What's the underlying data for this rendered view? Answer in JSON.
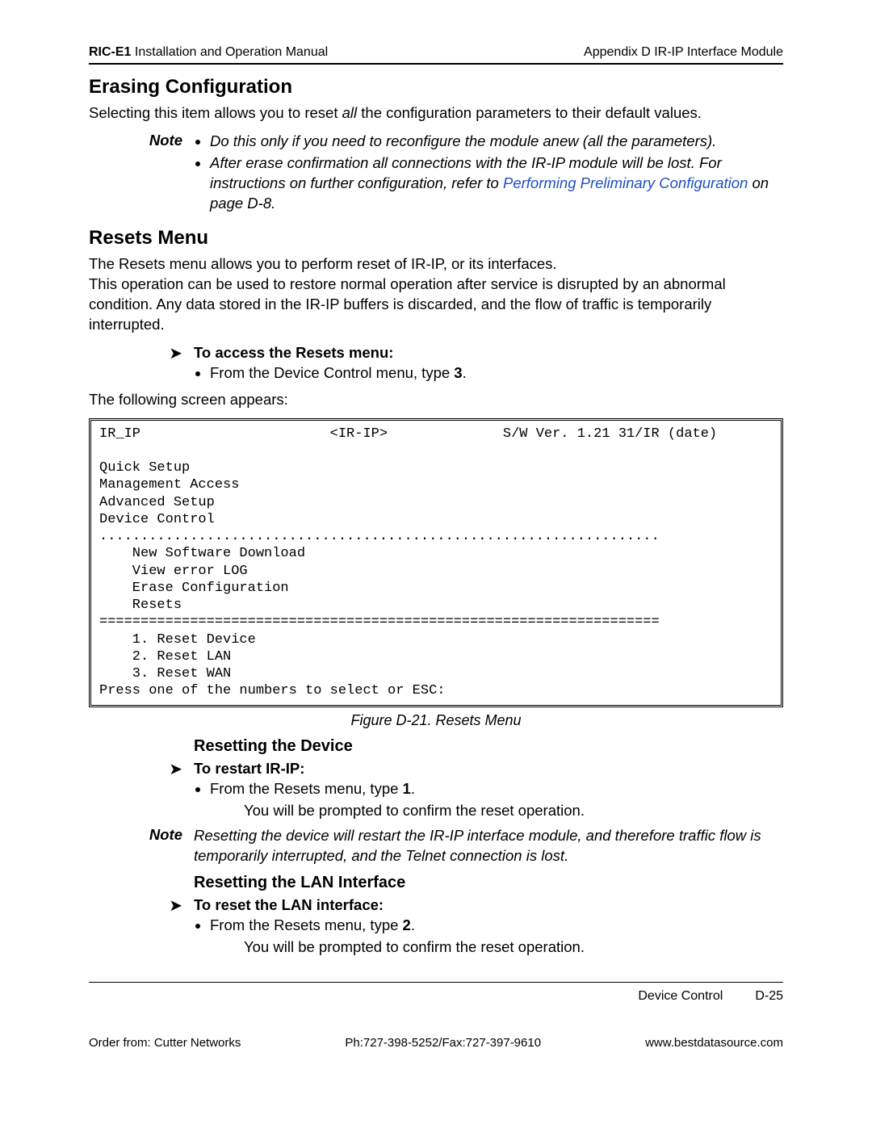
{
  "header": {
    "manual_prefix": "RIC-E1",
    "manual_rest": " Installation and Operation Manual",
    "appendix": "Appendix D  IR-IP Interface Module"
  },
  "section1": {
    "title": "Erasing Configuration",
    "para_a": "Selecting this item allows you to reset ",
    "para_b_italic": "all",
    "para_c": " the configuration parameters to their default values."
  },
  "note1": {
    "label": "Note",
    "bullet1": "Do this only if you need to reconfigure the module anew (all the parameters).",
    "bullet2_a": "After erase confirmation all connections with the IR-IP module will be lost. For instructions on further configuration, refer to ",
    "bullet2_link": "Performing Preliminary Configuration",
    "bullet2_b": " on page D-8."
  },
  "section2": {
    "title": "Resets Menu",
    "para": "The Resets menu allows you to perform reset of IR-IP, or its interfaces.\nThis operation can be used to restore normal operation after service is disrupted by an abnormal condition. Any data stored in the IR-IP buffers is discarded, and the flow of traffic is temporarily interrupted.",
    "proc_title": "To access the Resets menu:",
    "proc_step_a": "From the Device Control menu, type ",
    "proc_step_b": "3",
    "proc_step_c": ".",
    "proc_after": "The following screen appears:"
  },
  "terminal": "IR_IP                       <IR-IP>              S/W Ver. 1.21 31/IR (date)\n\nQuick Setup\nManagement Access\nAdvanced Setup\nDevice Control\n....................................................................\n    New Software Download\n    View error LOG\n    Erase Configuration\n    Resets\n====================================================================\n    1. Reset Device\n    2. Reset LAN\n    3. Reset WAN\nPress one of the numbers to select or ESC:",
  "figure_caption": "Figure D-21.  Resets Menu",
  "sub1": {
    "title": "Resetting the Device",
    "proc_title": "To restart IR-IP:",
    "step_a": "From the Resets menu, type ",
    "step_b": "1",
    "step_c": ".",
    "after": "You will be prompted to confirm the reset operation."
  },
  "note2": {
    "label": "Note",
    "text": "Resetting the device will restart the IR-IP interface module, and therefore traffic flow is temporarily interrupted, and the Telnet connection is lost."
  },
  "sub2": {
    "title": "Resetting the LAN Interface",
    "proc_title": "To reset the LAN interface:",
    "step_a": "From the Resets menu, type ",
    "step_b": "2",
    "step_c": ".",
    "after": "You will be prompted to confirm the reset operation."
  },
  "footer": {
    "section": "Device Control",
    "page": "D-25"
  },
  "print_footer": {
    "left": "Order from: Cutter Networks",
    "mid": "Ph:727-398-5252/Fax:727-397-9610",
    "right": "www.bestdatasource.com"
  }
}
